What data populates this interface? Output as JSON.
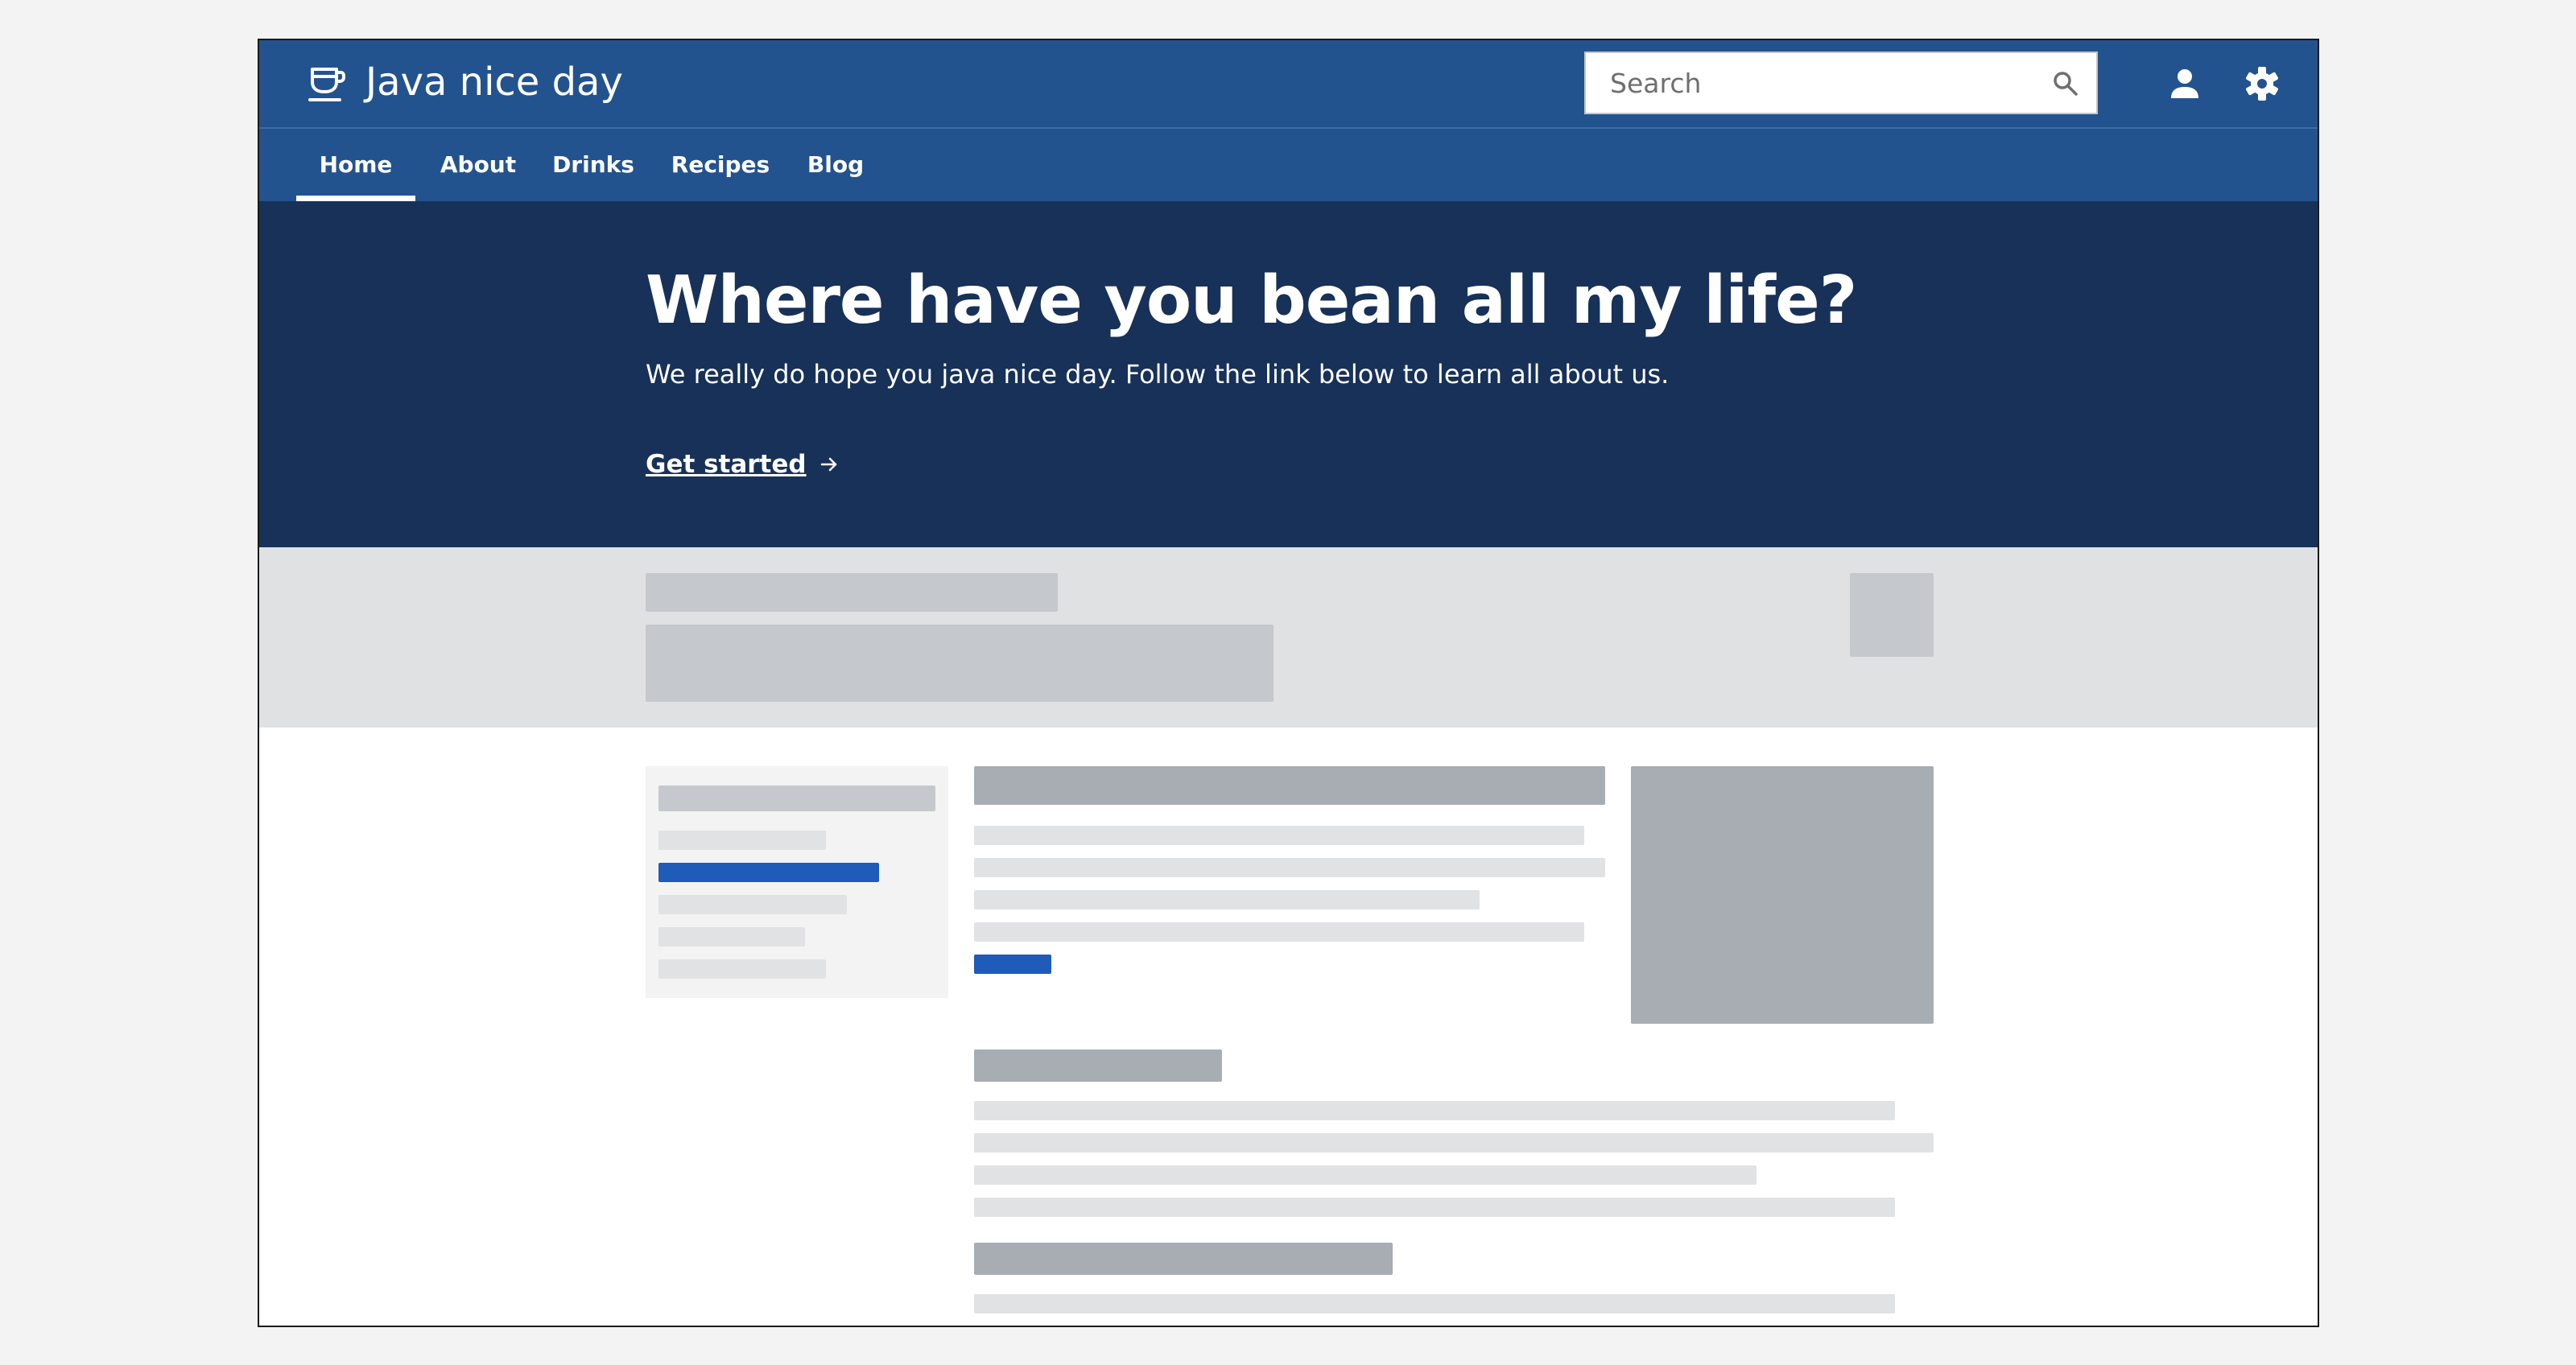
{
  "app": {
    "title": "Java nice day",
    "logo_icon": "coffee-cup-icon"
  },
  "search": {
    "placeholder": "Search",
    "icon": "search-icon"
  },
  "header_actions": [
    {
      "name": "user",
      "icon": "user-icon"
    },
    {
      "name": "settings",
      "icon": "gear-icon"
    }
  ],
  "nav": {
    "tabs": [
      {
        "label": "Home",
        "active": true
      },
      {
        "label": "About",
        "active": false
      },
      {
        "label": "Drinks",
        "active": false
      },
      {
        "label": "Recipes",
        "active": false
      },
      {
        "label": "Blog",
        "active": false
      }
    ]
  },
  "hero": {
    "title": "Where have you bean all my life?",
    "subtitle": "We really do hope you java nice day. Follow the link below to learn all about us.",
    "cta_label": "Get started",
    "cta_icon": "arrow-right-icon"
  },
  "colors": {
    "header_bg": "#23538f",
    "hero_bg": "#173158",
    "accent": "#1f5bb8",
    "page_bg": "#f3f3f3"
  }
}
